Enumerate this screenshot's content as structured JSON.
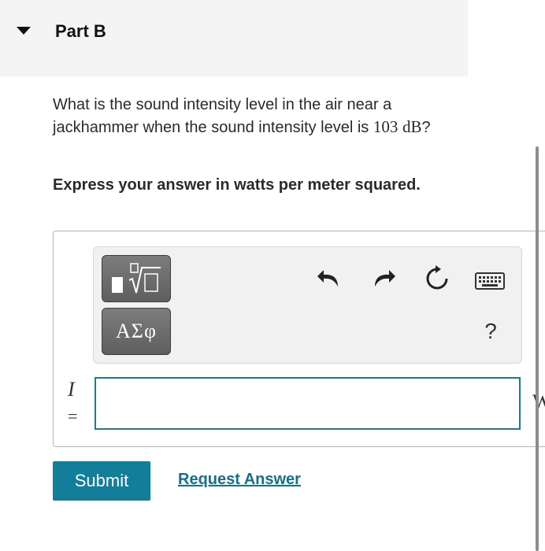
{
  "header": {
    "title": "Part B"
  },
  "question": {
    "text_before": "What is the sound intensity level in the air near a jackhammer when the sound intensity level is",
    "value": "103",
    "unit": "dB",
    "text_after": "?"
  },
  "instruction": "Express your answer in watts per meter squared.",
  "toolbar": {
    "templates_icon": "templates-icon",
    "symbols_label": "ΑΣφ",
    "help_label": "?"
  },
  "answer": {
    "variable": "I",
    "equals": "=",
    "value": "",
    "unit_partial": "W"
  },
  "actions": {
    "submit_label": "Submit",
    "request_label": "Request Answer"
  },
  "colors": {
    "accent": "#137e9a",
    "link": "#15708c",
    "input_border": "#227a92"
  }
}
